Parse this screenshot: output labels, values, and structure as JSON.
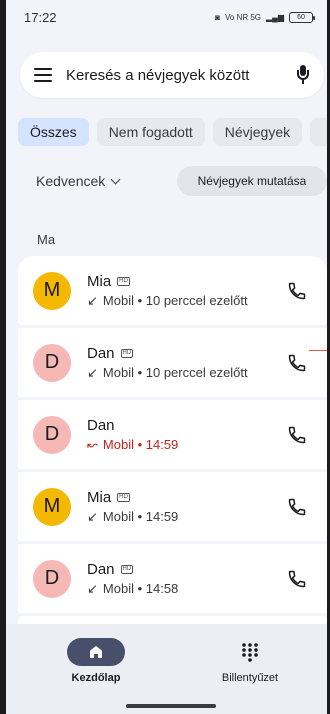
{
  "status": {
    "time": "17:22",
    "network": "Vo NR 5G",
    "battery": "60"
  },
  "search": {
    "placeholder": "Keresés a névjegyek között"
  },
  "tabs": [
    {
      "label": "Összes",
      "active": true
    },
    {
      "label": "Nem fogadott",
      "active": false
    },
    {
      "label": "Névjegyek",
      "active": false
    }
  ],
  "favorites": {
    "label": "Kedvencek",
    "show_contacts": "Névjegyek mutatása"
  },
  "section": "Ma",
  "calls": [
    {
      "initial": "M",
      "name": "Mia",
      "hd": "HD",
      "arrow": "↙",
      "detail": "Mobil • 10 perccel ezelőtt",
      "missed": false,
      "avatar_color": "#f5b800"
    },
    {
      "initial": "D",
      "name": "Dan",
      "hd": "HD",
      "arrow": "↙",
      "detail": "Mobil • 10 perccel ezelőtt",
      "missed": false,
      "avatar_color": "#f6b8b5"
    },
    {
      "initial": "D",
      "name": "Dan",
      "hd": "",
      "arrow": "↜",
      "detail": "Mobil • 14:59",
      "missed": true,
      "avatar_color": "#f6b8b5"
    },
    {
      "initial": "M",
      "name": "Mia",
      "hd": "HD",
      "arrow": "↙",
      "detail": "Mobil • 14:59",
      "missed": false,
      "avatar_color": "#f5b800"
    },
    {
      "initial": "D",
      "name": "Dan",
      "hd": "HD",
      "arrow": "↙",
      "detail": "Mobil • 14:58",
      "missed": false,
      "avatar_color": "#f6b8b5"
    }
  ],
  "nav": {
    "home": "Kezdőlap",
    "keypad": "Billentyűzet"
  },
  "colors": {
    "accent_chip": "#d4e3ff",
    "missed": "#c5221f",
    "nav_active": "#474f6b"
  }
}
